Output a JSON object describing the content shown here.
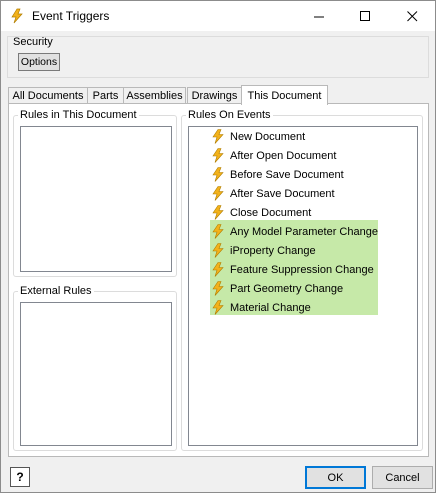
{
  "window": {
    "title": "Event Triggers",
    "icon": "lightning-icon",
    "controls": [
      "minimize",
      "maximize",
      "close"
    ]
  },
  "security": {
    "label": "Security",
    "options_label": "Options"
  },
  "tabs": [
    {
      "label": "All Documents",
      "active": false
    },
    {
      "label": "Parts",
      "active": false
    },
    {
      "label": "Assemblies",
      "active": false
    },
    {
      "label": "Drawings",
      "active": false
    },
    {
      "label": "This Document",
      "active": true
    }
  ],
  "panels": {
    "rules_in_doc": {
      "label": "Rules in This Document"
    },
    "external_rules": {
      "label": "External Rules"
    },
    "rules_on_events": {
      "label": "Rules On Events",
      "events": [
        {
          "label": "New Document",
          "highlighted": false
        },
        {
          "label": "After Open Document",
          "highlighted": false
        },
        {
          "label": "Before Save Document",
          "highlighted": false
        },
        {
          "label": "After Save Document",
          "highlighted": false
        },
        {
          "label": "Close Document",
          "highlighted": false
        },
        {
          "label": "Any Model Parameter Change",
          "highlighted": true
        },
        {
          "label": "iProperty Change",
          "highlighted": true
        },
        {
          "label": "Feature Suppression Change",
          "highlighted": true
        },
        {
          "label": "Part Geometry Change",
          "highlighted": true
        },
        {
          "label": "Material Change",
          "highlighted": true
        }
      ]
    }
  },
  "footer": {
    "help_label": "?",
    "ok_label": "OK",
    "cancel_label": "Cancel"
  },
  "colors": {
    "highlight": "#c6e9a8",
    "bolt": "#f3b21b",
    "accent": "#0078d7"
  }
}
